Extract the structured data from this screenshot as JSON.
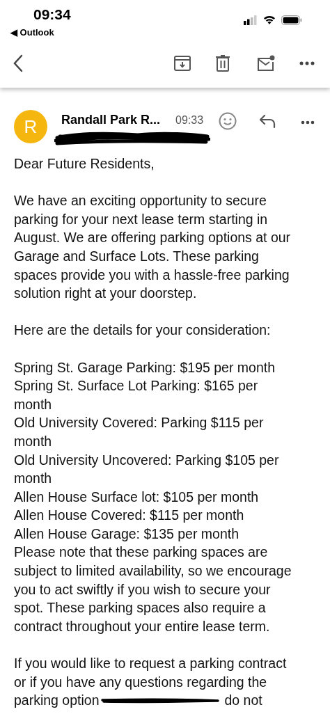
{
  "status_bar": {
    "time": "09:34",
    "back_app": "◀ Outlook"
  },
  "message": {
    "avatar": {
      "letter": "R",
      "color": "#f5b70f"
    },
    "sender": "Randall Park R...",
    "time": "09:33"
  },
  "body": {
    "paragraphs": [
      [
        "Dear Future Residents,"
      ],
      [
        "We have an exciting opportunity to secure",
        "parking for your next lease term starting in",
        "August. We are offering parking options at our",
        "Garage and Surface Lots. These parking",
        "spaces provide you with a hassle-free parking",
        "solution right at your doorstep."
      ],
      [
        "Here are the details for your consideration:"
      ],
      [
        "Spring St. Garage Parking: $195 per month",
        "Spring St. Surface Lot Parking: $165 per",
        "month",
        "Old University Covered: Parking $115 per",
        "month",
        "Old University Uncovered: Parking $105 per",
        "month",
        "Allen House Surface lot: $105 per month",
        "Allen House Covered: $115 per month",
        "Allen House Garage: $135 per month",
        "Please note that these parking spaces are",
        "subject to limited availability, so we encourage",
        "you to act swiftly if you wish to secure your",
        "spot. These parking spaces also require a",
        "contract throughout your entire lease term."
      ],
      [
        "If you would like to request a parking contract",
        "or if you have any questions regarding the"
      ]
    ],
    "last_line": {
      "before": "parking option",
      "after": "do not"
    }
  }
}
